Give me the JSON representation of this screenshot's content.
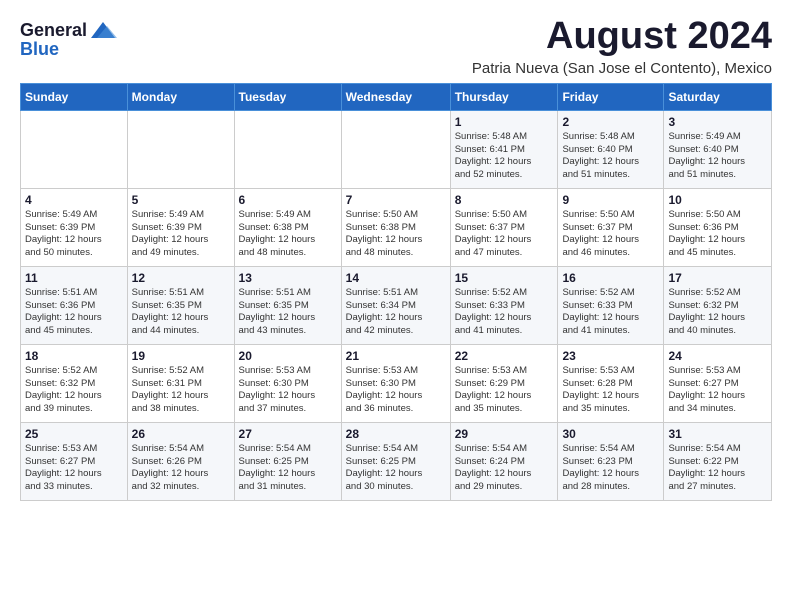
{
  "logo": {
    "general": "General",
    "blue": "Blue"
  },
  "title": "August 2024",
  "subtitle": "Patria Nueva (San Jose el Contento), Mexico",
  "headers": [
    "Sunday",
    "Monday",
    "Tuesday",
    "Wednesday",
    "Thursday",
    "Friday",
    "Saturday"
  ],
  "weeks": [
    [
      {
        "day": "",
        "info": ""
      },
      {
        "day": "",
        "info": ""
      },
      {
        "day": "",
        "info": ""
      },
      {
        "day": "",
        "info": ""
      },
      {
        "day": "1",
        "info": "Sunrise: 5:48 AM\nSunset: 6:41 PM\nDaylight: 12 hours\nand 52 minutes."
      },
      {
        "day": "2",
        "info": "Sunrise: 5:48 AM\nSunset: 6:40 PM\nDaylight: 12 hours\nand 51 minutes."
      },
      {
        "day": "3",
        "info": "Sunrise: 5:49 AM\nSunset: 6:40 PM\nDaylight: 12 hours\nand 51 minutes."
      }
    ],
    [
      {
        "day": "4",
        "info": "Sunrise: 5:49 AM\nSunset: 6:39 PM\nDaylight: 12 hours\nand 50 minutes."
      },
      {
        "day": "5",
        "info": "Sunrise: 5:49 AM\nSunset: 6:39 PM\nDaylight: 12 hours\nand 49 minutes."
      },
      {
        "day": "6",
        "info": "Sunrise: 5:49 AM\nSunset: 6:38 PM\nDaylight: 12 hours\nand 48 minutes."
      },
      {
        "day": "7",
        "info": "Sunrise: 5:50 AM\nSunset: 6:38 PM\nDaylight: 12 hours\nand 48 minutes."
      },
      {
        "day": "8",
        "info": "Sunrise: 5:50 AM\nSunset: 6:37 PM\nDaylight: 12 hours\nand 47 minutes."
      },
      {
        "day": "9",
        "info": "Sunrise: 5:50 AM\nSunset: 6:37 PM\nDaylight: 12 hours\nand 46 minutes."
      },
      {
        "day": "10",
        "info": "Sunrise: 5:50 AM\nSunset: 6:36 PM\nDaylight: 12 hours\nand 45 minutes."
      }
    ],
    [
      {
        "day": "11",
        "info": "Sunrise: 5:51 AM\nSunset: 6:36 PM\nDaylight: 12 hours\nand 45 minutes."
      },
      {
        "day": "12",
        "info": "Sunrise: 5:51 AM\nSunset: 6:35 PM\nDaylight: 12 hours\nand 44 minutes."
      },
      {
        "day": "13",
        "info": "Sunrise: 5:51 AM\nSunset: 6:35 PM\nDaylight: 12 hours\nand 43 minutes."
      },
      {
        "day": "14",
        "info": "Sunrise: 5:51 AM\nSunset: 6:34 PM\nDaylight: 12 hours\nand 42 minutes."
      },
      {
        "day": "15",
        "info": "Sunrise: 5:52 AM\nSunset: 6:33 PM\nDaylight: 12 hours\nand 41 minutes."
      },
      {
        "day": "16",
        "info": "Sunrise: 5:52 AM\nSunset: 6:33 PM\nDaylight: 12 hours\nand 41 minutes."
      },
      {
        "day": "17",
        "info": "Sunrise: 5:52 AM\nSunset: 6:32 PM\nDaylight: 12 hours\nand 40 minutes."
      }
    ],
    [
      {
        "day": "18",
        "info": "Sunrise: 5:52 AM\nSunset: 6:32 PM\nDaylight: 12 hours\nand 39 minutes."
      },
      {
        "day": "19",
        "info": "Sunrise: 5:52 AM\nSunset: 6:31 PM\nDaylight: 12 hours\nand 38 minutes."
      },
      {
        "day": "20",
        "info": "Sunrise: 5:53 AM\nSunset: 6:30 PM\nDaylight: 12 hours\nand 37 minutes."
      },
      {
        "day": "21",
        "info": "Sunrise: 5:53 AM\nSunset: 6:30 PM\nDaylight: 12 hours\nand 36 minutes."
      },
      {
        "day": "22",
        "info": "Sunrise: 5:53 AM\nSunset: 6:29 PM\nDaylight: 12 hours\nand 35 minutes."
      },
      {
        "day": "23",
        "info": "Sunrise: 5:53 AM\nSunset: 6:28 PM\nDaylight: 12 hours\nand 35 minutes."
      },
      {
        "day": "24",
        "info": "Sunrise: 5:53 AM\nSunset: 6:27 PM\nDaylight: 12 hours\nand 34 minutes."
      }
    ],
    [
      {
        "day": "25",
        "info": "Sunrise: 5:53 AM\nSunset: 6:27 PM\nDaylight: 12 hours\nand 33 minutes."
      },
      {
        "day": "26",
        "info": "Sunrise: 5:54 AM\nSunset: 6:26 PM\nDaylight: 12 hours\nand 32 minutes."
      },
      {
        "day": "27",
        "info": "Sunrise: 5:54 AM\nSunset: 6:25 PM\nDaylight: 12 hours\nand 31 minutes."
      },
      {
        "day": "28",
        "info": "Sunrise: 5:54 AM\nSunset: 6:25 PM\nDaylight: 12 hours\nand 30 minutes."
      },
      {
        "day": "29",
        "info": "Sunrise: 5:54 AM\nSunset: 6:24 PM\nDaylight: 12 hours\nand 29 minutes."
      },
      {
        "day": "30",
        "info": "Sunrise: 5:54 AM\nSunset: 6:23 PM\nDaylight: 12 hours\nand 28 minutes."
      },
      {
        "day": "31",
        "info": "Sunrise: 5:54 AM\nSunset: 6:22 PM\nDaylight: 12 hours\nand 27 minutes."
      }
    ]
  ]
}
